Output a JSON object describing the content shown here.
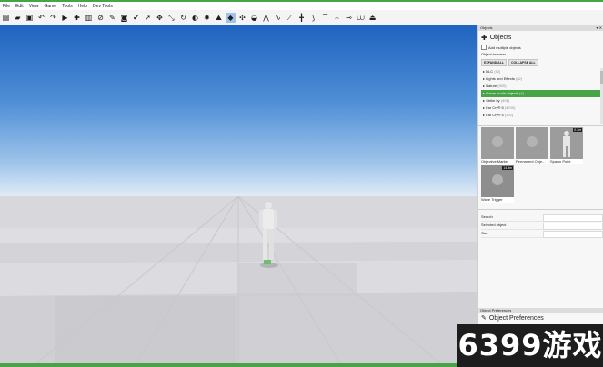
{
  "menu": [
    "File",
    "Edit",
    "View",
    "Game",
    "Tools",
    "Help",
    "Dev Tools"
  ],
  "toolbar": {
    "icons": [
      {
        "name": "new-file-icon",
        "glyph": "▤"
      },
      {
        "name": "open-folder-icon",
        "glyph": "▰"
      },
      {
        "name": "save-icon",
        "glyph": "▣"
      },
      {
        "name": "undo-icon",
        "glyph": "↶"
      },
      {
        "name": "redo-icon",
        "glyph": "↷"
      },
      {
        "name": "play-icon",
        "glyph": "▶"
      },
      {
        "name": "add-object-icon",
        "glyph": "✚"
      },
      {
        "name": "clipboard-icon",
        "glyph": "▥"
      },
      {
        "name": "no-entry-icon",
        "glyph": "⊘"
      },
      {
        "name": "wrench-icon",
        "glyph": "✎"
      },
      {
        "name": "camera-icon",
        "glyph": "◙"
      },
      {
        "name": "checkmark-icon",
        "glyph": "✔"
      },
      {
        "name": "select-icon",
        "glyph": "➚"
      },
      {
        "name": "move-icon",
        "glyph": "✥"
      },
      {
        "name": "scale-icon",
        "glyph": "⤡"
      },
      {
        "name": "rotate-icon",
        "glyph": "↻"
      },
      {
        "name": "snap-icon",
        "glyph": "◐"
      },
      {
        "name": "paint-icon",
        "glyph": "✹"
      },
      {
        "name": "terrain-icon",
        "glyph": "⛰"
      },
      {
        "name": "spawn-icon",
        "glyph": "◆"
      },
      {
        "name": "link-icon",
        "glyph": "✣"
      },
      {
        "name": "vehicle-icon",
        "glyph": "◒"
      },
      {
        "name": "road-icon",
        "glyph": "⋀"
      },
      {
        "name": "wave-icon",
        "glyph": "∿"
      },
      {
        "name": "line-icon",
        "glyph": "⟋"
      },
      {
        "name": "cross-icon",
        "glyph": "╋"
      },
      {
        "name": "path-icon",
        "glyph": "⟆"
      },
      {
        "name": "trend-icon",
        "glyph": "⌒"
      },
      {
        "name": "arch-icon",
        "glyph": "⌢"
      },
      {
        "name": "spline-icon",
        "glyph": "⊸"
      },
      {
        "name": "boat-icon",
        "glyph": "⩊"
      },
      {
        "name": "platform-icon",
        "glyph": "⏏"
      }
    ]
  },
  "objects_panel": {
    "title": "Objects",
    "heading": "Objects",
    "add_multiple": "Add multiple objects",
    "browser_label": "Object browser",
    "expand_all": "EXPAND ALL",
    "collapse_all": "COLLAPSE ALL",
    "tree": [
      {
        "label": "DLC",
        "count": "(92)"
      },
      {
        "label": "Lights and Effects",
        "count": "(82)"
      },
      {
        "label": "Nature",
        "count": "(500)"
      },
      {
        "label": "Game mode objects",
        "count": "(4)"
      },
      {
        "label": "Strike by",
        "count": "(491)"
      },
      {
        "label": "Far Cry® 5",
        "count": "(4700)"
      },
      {
        "label": "Far Cry® 4",
        "count": "(392)"
      }
    ],
    "selected_index": 3,
    "thumbnails": [
      {
        "caption": "Objective Marker",
        "badge": ""
      },
      {
        "caption": "Permanent Obje...",
        "badge": ""
      },
      {
        "caption": "Spawn Point",
        "badge": "0.3m"
      },
      {
        "caption": "Wave Trigger",
        "badge": "14.3m"
      }
    ],
    "properties": [
      "Search",
      "Selected object",
      "Size"
    ]
  },
  "preferences_panel": {
    "title": "Object Preferences",
    "heading": "Object Preferences"
  },
  "watermark": "6399游戏",
  "colors": {
    "accent": "#47a447",
    "sky_top": "#1f64c0",
    "ground": "#d8d8dc"
  }
}
